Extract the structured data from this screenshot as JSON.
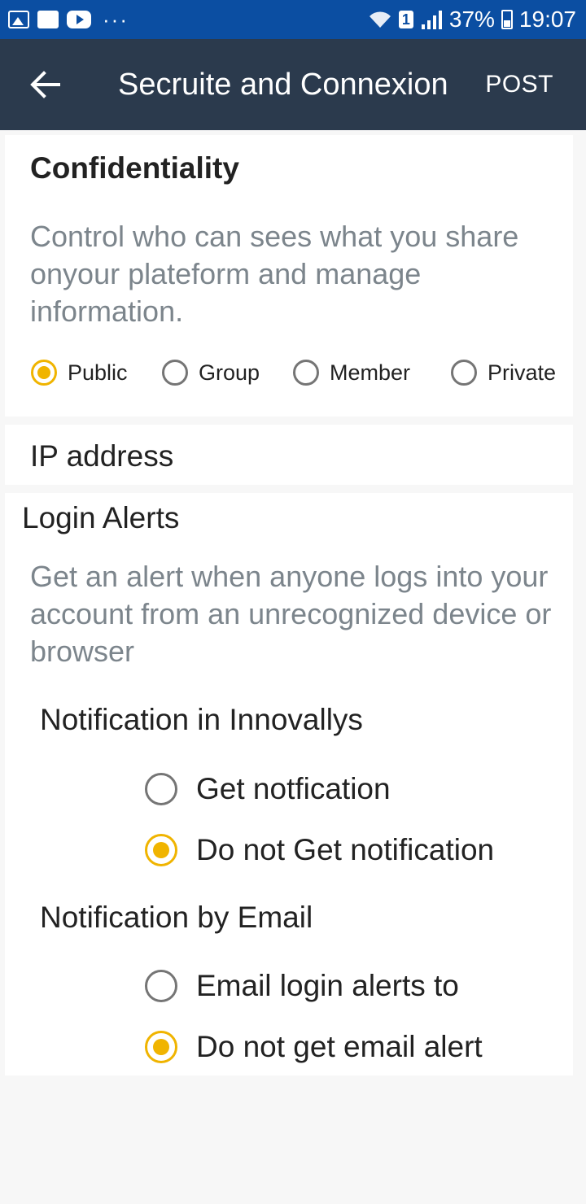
{
  "status_bar": {
    "badge": "1",
    "battery": "37%",
    "time": "19:07",
    "overflow": "···"
  },
  "app_bar": {
    "title": "Secruite and Connexion",
    "action": "POST"
  },
  "confidentiality": {
    "title": "Confidentiality",
    "description": "Control who can sees what you share onyour plateform and manage information.",
    "options": [
      {
        "label": "Public",
        "checked": true
      },
      {
        "label": "Group",
        "checked": false
      },
      {
        "label": "Member",
        "checked": false
      },
      {
        "label": "Private",
        "checked": false
      }
    ]
  },
  "ip": {
    "label": "IP address"
  },
  "login_alerts": {
    "title": "Login Alerts",
    "description": "Get an alert when anyone logs into your account from an unrecognized device or browser",
    "innovallys": {
      "title": "Notification in Innovallys",
      "options": [
        {
          "label": "Get notfication",
          "checked": false
        },
        {
          "label": "Do not Get notification",
          "checked": true
        }
      ]
    },
    "email": {
      "title": "Notification by Email",
      "options": [
        {
          "label": "Email login alerts to",
          "checked": false
        },
        {
          "label": "Do not get email alert",
          "checked": true
        }
      ]
    }
  },
  "colors": {
    "status_bar": "#0b4ea2",
    "app_bar": "#2b3a4d",
    "accent": "#f0b400",
    "muted_text": "#7c858c"
  }
}
